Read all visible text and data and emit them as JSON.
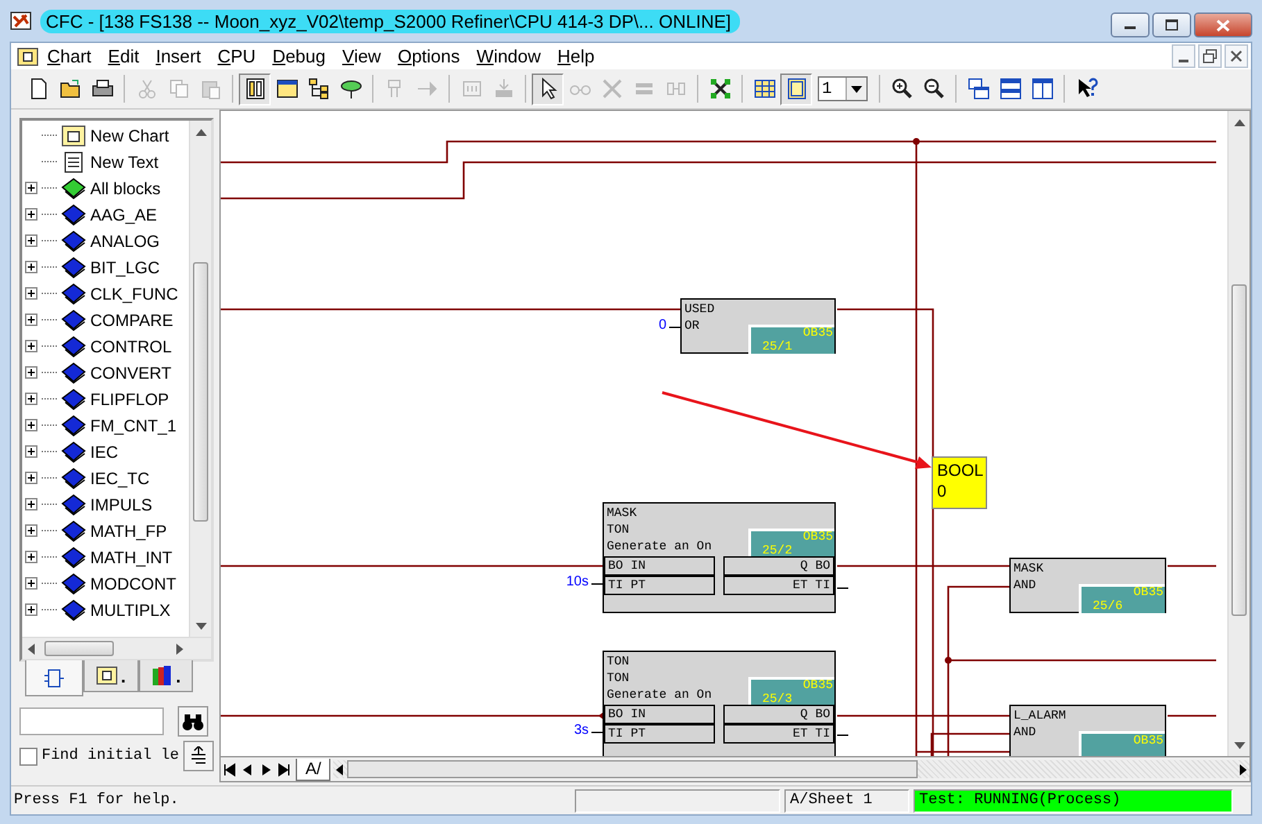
{
  "window": {
    "title": "CFC - [138 FS138 -- Moon_xyz_V02\\temp_S2000 Refiner\\CPU 414-3 DP\\...  ONLINE]"
  },
  "menu": [
    "Chart",
    "Edit",
    "Insert",
    "CPU",
    "Debug",
    "View",
    "Options",
    "Window",
    "Help"
  ],
  "toolbar": [
    {
      "kind": "button",
      "disabled": false,
      "pressed": false
    },
    {
      "kind": "button",
      "disabled": false,
      "pressed": false
    },
    {
      "kind": "button",
      "disabled": false,
      "pressed": false
    },
    {
      "kind": "separator"
    },
    {
      "kind": "button",
      "disabled": true,
      "pressed": false
    },
    {
      "kind": "button",
      "disabled": true,
      "pressed": false
    },
    {
      "kind": "button",
      "disabled": true,
      "pressed": false
    },
    {
      "kind": "separator"
    },
    {
      "kind": "button",
      "disabled": false,
      "pressed": true
    },
    {
      "kind": "button",
      "disabled": false,
      "pressed": false
    },
    {
      "kind": "button",
      "disabled": false,
      "pressed": false
    },
    {
      "kind": "button",
      "disabled": false,
      "pressed": false
    },
    {
      "kind": "separator"
    },
    {
      "kind": "button",
      "disabled": true,
      "pressed": false
    },
    {
      "kind": "button",
      "disabled": true,
      "pressed": false
    },
    {
      "kind": "separator"
    },
    {
      "kind": "button",
      "disabled": true,
      "pressed": false
    },
    {
      "kind": "button",
      "disabled": true,
      "pressed": false
    },
    {
      "kind": "separator"
    },
    {
      "kind": "button",
      "disabled": false,
      "pressed": true
    },
    {
      "kind": "button",
      "disabled": true,
      "pressed": false
    },
    {
      "kind": "button",
      "disabled": true,
      "pressed": false
    },
    {
      "kind": "button",
      "disabled": true,
      "pressed": false
    },
    {
      "kind": "button",
      "disabled": true,
      "pressed": false
    },
    {
      "kind": "separator"
    },
    {
      "kind": "button",
      "disabled": false,
      "pressed": false
    },
    {
      "kind": "separator"
    },
    {
      "kind": "button",
      "disabled": false,
      "pressed": false
    },
    {
      "kind": "button",
      "disabled": false,
      "pressed": true
    },
    {
      "kind": "select",
      "value": "1"
    },
    {
      "kind": "separator"
    },
    {
      "kind": "button",
      "disabled": false,
      "pressed": false
    },
    {
      "kind": "button",
      "disabled": false,
      "pressed": false
    },
    {
      "kind": "separator"
    },
    {
      "kind": "button",
      "disabled": false,
      "pressed": false
    },
    {
      "kind": "button",
      "disabled": false,
      "pressed": false
    },
    {
      "kind": "button",
      "disabled": false,
      "pressed": false
    },
    {
      "kind": "separator"
    },
    {
      "kind": "button",
      "disabled": false,
      "pressed": false
    }
  ],
  "library": {
    "tree": [
      {
        "label": "New Chart",
        "kind": "chart"
      },
      {
        "label": "New Text",
        "kind": "text"
      },
      {
        "label": "All blocks",
        "kind": "all",
        "expanded": false
      },
      {
        "label": "AAG_AE",
        "kind": "library",
        "expanded": false
      },
      {
        "label": "ANALOG",
        "kind": "library",
        "expanded": false
      },
      {
        "label": "BIT_LGC",
        "kind": "library",
        "expanded": false
      },
      {
        "label": "CLK_FUNC",
        "kind": "library",
        "expanded": false
      },
      {
        "label": "COMPARE",
        "kind": "library",
        "expanded": false
      },
      {
        "label": "CONTROL",
        "kind": "library",
        "expanded": false
      },
      {
        "label": "CONVERT",
        "kind": "library",
        "expanded": false
      },
      {
        "label": "FLIPFLOP",
        "kind": "library",
        "expanded": false
      },
      {
        "label": "FM_CNT_1",
        "kind": "library",
        "expanded": false
      },
      {
        "label": "IEC",
        "kind": "library",
        "expanded": false
      },
      {
        "label": "IEC_TC",
        "kind": "library",
        "expanded": false
      },
      {
        "label": "IMPULS",
        "kind": "library",
        "expanded": false
      },
      {
        "label": "MATH_FP",
        "kind": "library",
        "expanded": false
      },
      {
        "label": "MATH_INT",
        "kind": "library",
        "expanded": false
      },
      {
        "label": "MODCONT",
        "kind": "library",
        "expanded": false
      },
      {
        "label": "MULTIPLX",
        "kind": "library",
        "expanded": false
      }
    ],
    "tabs": [
      {
        "selected": true
      },
      {
        "label": ".",
        "selected": false
      },
      {
        "label": ".",
        "selected": false
      }
    ],
    "find_option": {
      "label": "Find initial le",
      "checked": false
    }
  },
  "chart": {
    "blocks": [
      {
        "name": "USED",
        "type": "OR",
        "task": "OB35",
        "seq": "25/1",
        "value": "0"
      },
      {
        "name": "MASK",
        "type": "TON",
        "comment": "Generate an On",
        "task": "OB35",
        "seq": "25/2",
        "pins": [
          {
            "in": "BO IN",
            "out": "Q BO"
          },
          {
            "in": "TI PT",
            "out": "ET TI",
            "value": "10s"
          }
        ]
      },
      {
        "name": "MASK",
        "type": "AND",
        "task": "OB35",
        "seq": "25/6"
      },
      {
        "name": "TON",
        "type": "TON",
        "comment": "Generate an On",
        "task": "OB35",
        "seq": "25/3",
        "pins": [
          {
            "in": "BO IN",
            "out": "Q BO"
          },
          {
            "in": "TI PT",
            "out": "ET TI",
            "value": "3s"
          }
        ]
      },
      {
        "name": "L_ALARM",
        "type": "AND",
        "task": "OB35"
      }
    ],
    "monitor": {
      "type": "BOOL",
      "value": "0"
    }
  },
  "sheet_tabs": [
    {
      "label": "A/",
      "selected": true
    }
  ],
  "status_bar": {
    "help": "Press F1 for help.",
    "sheet": "A/Sheet 1",
    "test": "Test: RUNNING(Process)"
  }
}
